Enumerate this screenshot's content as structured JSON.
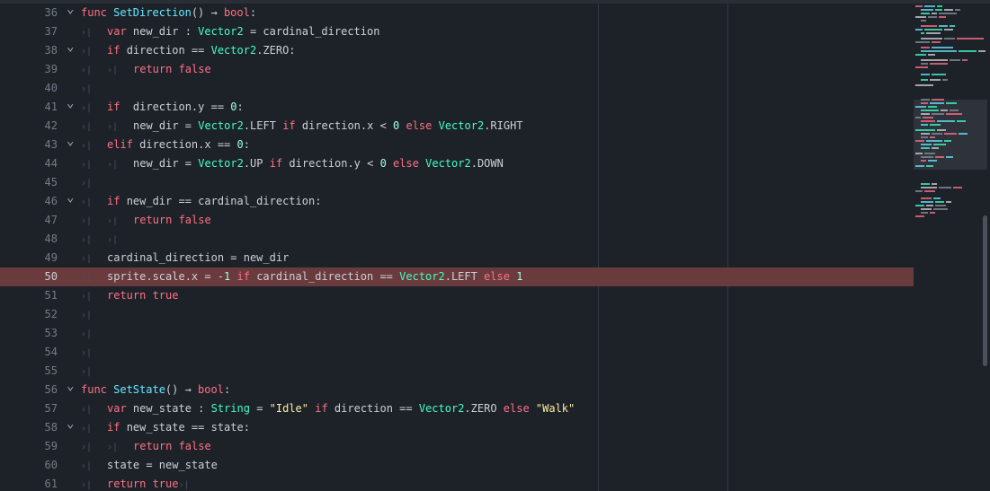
{
  "editor": {
    "lines": [
      {
        "num": "36",
        "fold": true,
        "tabs": 0,
        "tokens": [
          [
            "kw",
            "func "
          ],
          [
            "fn",
            "SetDirection"
          ],
          [
            "op",
            "() → "
          ],
          [
            "kw",
            "bool"
          ],
          [
            "op",
            ":"
          ]
        ]
      },
      {
        "num": "37",
        "fold": false,
        "tabs": 1,
        "tokens": [
          [
            "kw",
            "var "
          ],
          [
            "op",
            "new_dir : "
          ],
          [
            "ty",
            "Vector2"
          ],
          [
            "op",
            " = cardinal_direction"
          ]
        ]
      },
      {
        "num": "38",
        "fold": true,
        "tabs": 1,
        "tokens": [
          [
            "kw",
            "if "
          ],
          [
            "op",
            "direction == "
          ],
          [
            "ty",
            "Vector2"
          ],
          [
            "op",
            ".ZERO:"
          ]
        ]
      },
      {
        "num": "39",
        "fold": false,
        "tabs": 2,
        "tokens": [
          [
            "kw",
            "return false"
          ]
        ]
      },
      {
        "num": "40",
        "fold": false,
        "tabs": 1,
        "tokens": []
      },
      {
        "num": "41",
        "fold": true,
        "tabs": 1,
        "tokens": [
          [
            "kw",
            "if  "
          ],
          [
            "op",
            "direction.y == "
          ],
          [
            "num",
            "0"
          ],
          [
            "op",
            ":"
          ]
        ]
      },
      {
        "num": "42",
        "fold": false,
        "tabs": 2,
        "tokens": [
          [
            "op",
            "new_dir = "
          ],
          [
            "ty",
            "Vector2"
          ],
          [
            "op",
            ".LEFT "
          ],
          [
            "kw",
            "if "
          ],
          [
            "op",
            "direction.x < "
          ],
          [
            "num",
            "0 "
          ],
          [
            "kw",
            "else "
          ],
          [
            "ty",
            "Vector2"
          ],
          [
            "op",
            ".RIGHT"
          ]
        ]
      },
      {
        "num": "43",
        "fold": true,
        "tabs": 1,
        "tokens": [
          [
            "kw",
            "elif "
          ],
          [
            "op",
            "direction.x == "
          ],
          [
            "num",
            "0"
          ],
          [
            "op",
            ":"
          ]
        ]
      },
      {
        "num": "44",
        "fold": false,
        "tabs": 2,
        "tokens": [
          [
            "op",
            "new_dir = "
          ],
          [
            "ty",
            "Vector2"
          ],
          [
            "op",
            ".UP "
          ],
          [
            "kw",
            "if "
          ],
          [
            "op",
            "direction.y < "
          ],
          [
            "num",
            "0 "
          ],
          [
            "kw",
            "else "
          ],
          [
            "ty",
            "Vector2"
          ],
          [
            "op",
            ".DOWN"
          ]
        ]
      },
      {
        "num": "45",
        "fold": false,
        "tabs": 1,
        "tokens": []
      },
      {
        "num": "46",
        "fold": true,
        "tabs": 1,
        "tokens": [
          [
            "kw",
            "if "
          ],
          [
            "op",
            "new_dir == cardinal_direction:"
          ]
        ]
      },
      {
        "num": "47",
        "fold": false,
        "tabs": 2,
        "tokens": [
          [
            "kw",
            "return false"
          ]
        ]
      },
      {
        "num": "48",
        "fold": false,
        "tabs": 2,
        "tokens": []
      },
      {
        "num": "49",
        "fold": false,
        "tabs": 1,
        "tokens": [
          [
            "op",
            "cardinal_direction = new_dir"
          ]
        ]
      },
      {
        "num": "50",
        "fold": false,
        "tabs": 1,
        "highlight": true,
        "tokens": [
          [
            "op",
            "sprite.scale.x = -"
          ],
          [
            "num",
            "1 "
          ],
          [
            "kw",
            "if "
          ],
          [
            "op",
            "cardinal_direction == "
          ],
          [
            "ty",
            "Vector2"
          ],
          [
            "op",
            ".LEFT "
          ],
          [
            "kw",
            "else "
          ],
          [
            "num",
            "1"
          ]
        ]
      },
      {
        "num": "51",
        "fold": false,
        "tabs": 1,
        "tokens": [
          [
            "kw",
            "return true"
          ]
        ]
      },
      {
        "num": "52",
        "fold": false,
        "tabs": 1,
        "tokens": []
      },
      {
        "num": "53",
        "fold": false,
        "tabs": 1,
        "tokens": []
      },
      {
        "num": "54",
        "fold": false,
        "tabs": 1,
        "tokens": []
      },
      {
        "num": "55",
        "fold": false,
        "tabs": 1,
        "tokens": []
      },
      {
        "num": "56",
        "fold": true,
        "tabs": 0,
        "tokens": [
          [
            "kw",
            "func "
          ],
          [
            "fn",
            "SetState"
          ],
          [
            "op",
            "() → "
          ],
          [
            "kw",
            "bool"
          ],
          [
            "op",
            ":"
          ]
        ]
      },
      {
        "num": "57",
        "fold": false,
        "tabs": 1,
        "tokens": [
          [
            "kw",
            "var "
          ],
          [
            "op",
            "new_state : "
          ],
          [
            "ty",
            "String"
          ],
          [
            "op",
            " = "
          ],
          [
            "str",
            "\"Idle\" "
          ],
          [
            "kw",
            "if "
          ],
          [
            "op",
            "direction == "
          ],
          [
            "ty",
            "Vector2"
          ],
          [
            "op",
            ".ZERO "
          ],
          [
            "kw",
            "else "
          ],
          [
            "str",
            "\"Walk\""
          ]
        ]
      },
      {
        "num": "58",
        "fold": true,
        "tabs": 1,
        "tokens": [
          [
            "kw",
            "if "
          ],
          [
            "op",
            "new_state == state:"
          ]
        ]
      },
      {
        "num": "59",
        "fold": false,
        "tabs": 2,
        "tokens": [
          [
            "kw",
            "return false"
          ]
        ]
      },
      {
        "num": "60",
        "fold": false,
        "tabs": 1,
        "tokens": [
          [
            "op",
            "state = new_state"
          ]
        ]
      },
      {
        "num": "61",
        "fold": false,
        "tabs": 1,
        "trailingTab": true,
        "tokens": [
          [
            "kw",
            "return true"
          ]
        ]
      }
    ]
  },
  "icons": {
    "fold": "chevron-down-icon",
    "tab": "tab-indent-icon"
  },
  "colors": {
    "background": "#1d2229",
    "highlight": "#6a3b3d",
    "keyword": "#ff7085",
    "function": "#66e6ff",
    "type": "#42ffc2",
    "number": "#a1ffe0",
    "string": "#ffeda1"
  }
}
